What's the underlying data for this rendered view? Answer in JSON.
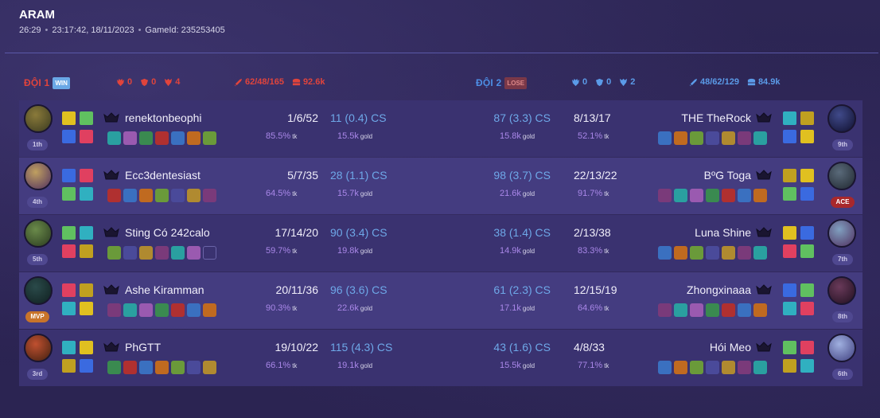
{
  "header": {
    "mode": "ARAM",
    "duration": "26:29",
    "datetime": "23:17:42, 18/11/2023",
    "game_id": "GameId: 235253405"
  },
  "colors": {
    "red_team": "#e0443c",
    "blue_team": "#4d8fe6",
    "accent_purple": "#a987e8",
    "cs_blue": "#6ea8e8"
  },
  "teams": {
    "left": {
      "name": "ĐỘI 1",
      "result": "WIN",
      "towers": "0",
      "inhibitors": "0",
      "barons": "4",
      "kda_total": "62/48/165",
      "gold_total": "92.6k"
    },
    "right": {
      "name": "ĐỘI 2",
      "result": "LOSE",
      "towers": "0",
      "inhibitors": "0",
      "barons": "2",
      "kda_total": "48/62/129",
      "gold_total": "84.9k"
    }
  },
  "left_players": [
    {
      "name": "renektonbeophi",
      "kda": "1/6/52",
      "kp": "85.5%",
      "cs": "11 (0.4) CS",
      "gold": "15.5k",
      "place": "1th"
    },
    {
      "name": "Ecc3dentesiast",
      "kda": "5/7/35",
      "kp": "64.5%",
      "cs": "28 (1.1) CS",
      "gold": "15.7k",
      "place": "4th"
    },
    {
      "name": "Sting Có 242calo",
      "kda": "17/14/20",
      "kp": "59.7%",
      "cs": "90 (3.4) CS",
      "gold": "19.8k",
      "place": "5th"
    },
    {
      "name": "Ashe Kiramman",
      "kda": "20/11/36",
      "kp": "90.3%",
      "cs": "96 (3.6) CS",
      "gold": "22.6k",
      "place": "MVP"
    },
    {
      "name": "PhGTT",
      "kda": "19/10/22",
      "kp": "66.1%",
      "cs": "115 (4.3) CS",
      "gold": "19.1k",
      "place": "3rd"
    }
  ],
  "right_players": [
    {
      "name": "THE TheRock",
      "kda": "8/13/17",
      "kp": "52.1%",
      "cs": "87 (3.3) CS",
      "gold": "15.8k",
      "place": "9th"
    },
    {
      "name": "BºG Toga",
      "kda": "22/13/22",
      "kp": "91.7%",
      "cs": "98 (3.7) CS",
      "gold": "21.6k",
      "place": "ACE"
    },
    {
      "name": "Luna Shine",
      "kda": "2/13/38",
      "kp": "83.3%",
      "cs": "38 (1.4) CS",
      "gold": "14.9k",
      "place": "7th"
    },
    {
      "name": "Zhongxinaaa",
      "kda": "12/15/19",
      "kp": "64.6%",
      "cs": "61 (2.3) CS",
      "gold": "17.1k",
      "place": "8th"
    },
    {
      "name": "Hói Meo",
      "kda": "4/8/33",
      "kp": "77.1%",
      "cs": "43 (1.6) CS",
      "gold": "15.5k",
      "place": "6th"
    }
  ],
  "units": {
    "kp": "tk",
    "gold": "gold"
  }
}
